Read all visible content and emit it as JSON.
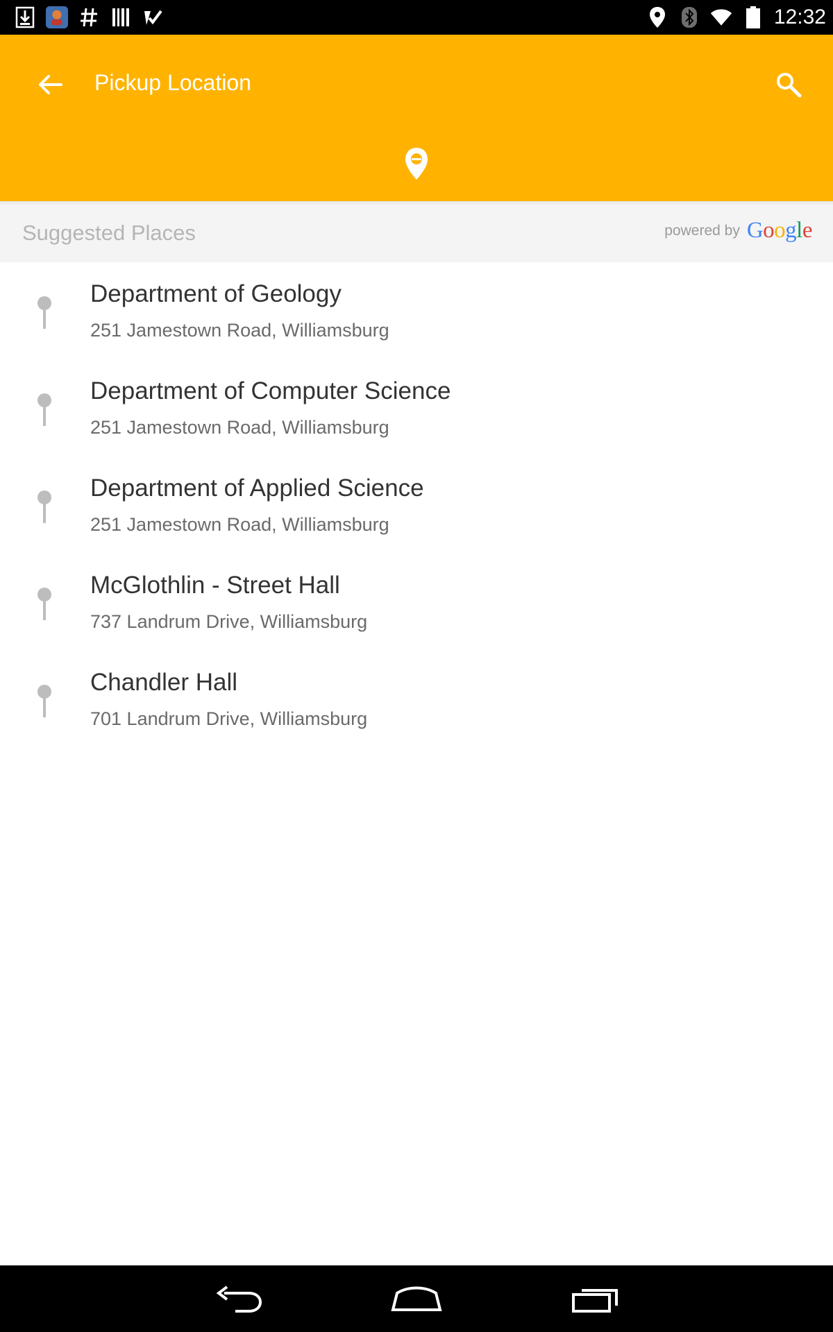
{
  "status_bar": {
    "time": "12:32",
    "left_icons": [
      "download-icon",
      "app-notification-icon",
      "hashtag-icon",
      "barcode-icon",
      "task-check-icon"
    ],
    "right_icons": [
      "location-icon",
      "bluetooth-icon",
      "wifi-icon",
      "battery-icon"
    ]
  },
  "app_bar": {
    "title": "Pickup Location",
    "back_icon": "arrow-back-icon",
    "search_icon": "search-icon",
    "tab_icon": "location-pin-icon",
    "background_color": "#ffb300"
  },
  "suggested": {
    "title": "Suggested Places",
    "powered_by": "powered by",
    "google_letters": [
      "G",
      "o",
      "o",
      "g",
      "l",
      "e"
    ]
  },
  "places": [
    {
      "name": "Department of Geology",
      "address": "251 Jamestown Road, Williamsburg"
    },
    {
      "name": "Department of Computer Science",
      "address": "251 Jamestown Road, Williamsburg"
    },
    {
      "name": "Department of Applied Science",
      "address": "251 Jamestown Road, Williamsburg"
    },
    {
      "name": "McGlothlin - Street Hall",
      "address": "737 Landrum Drive, Williamsburg"
    },
    {
      "name": "Chandler Hall",
      "address": "701 Landrum Drive, Williamsburg"
    }
  ],
  "nav_bar": {
    "icons": [
      "nav-back-icon",
      "nav-home-icon",
      "nav-recents-icon"
    ]
  }
}
